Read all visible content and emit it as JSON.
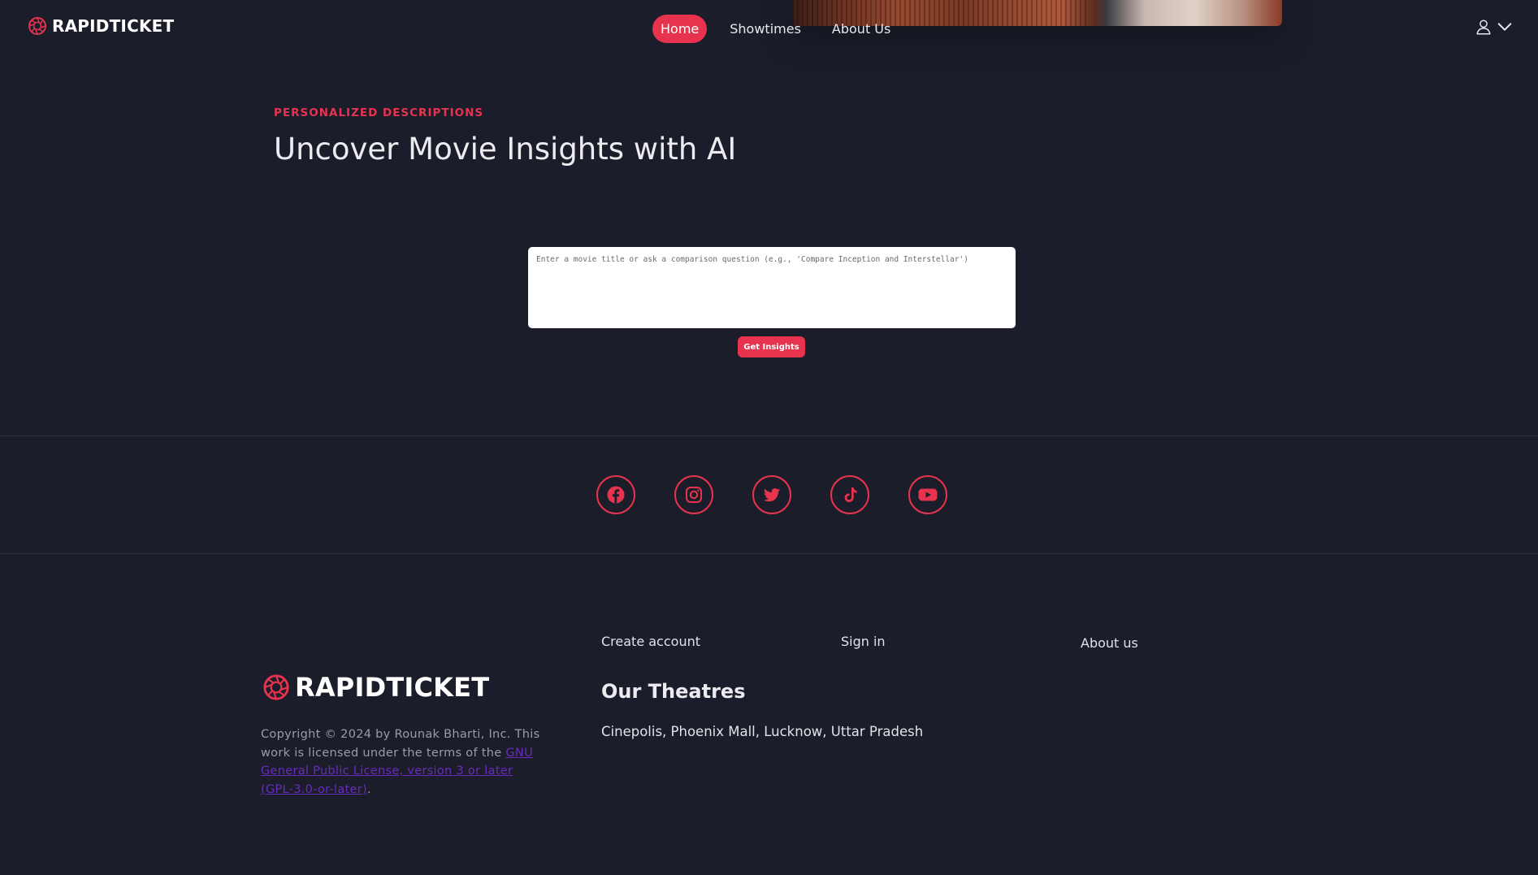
{
  "brand": {
    "name": "RAPIDTICKET",
    "accent_color": "#e8334f"
  },
  "nav": {
    "items": [
      {
        "label": "Home",
        "active": true
      },
      {
        "label": "Showtimes",
        "active": false
      },
      {
        "label": "About Us",
        "active": false
      }
    ]
  },
  "user_menu": {
    "icons": [
      "user-icon",
      "chevron-down-icon"
    ]
  },
  "hero": {
    "eyebrow": "PERSONALIZED DESCRIPTIONS",
    "title": "Uncover Movie Insights with AI",
    "query_placeholder": "Enter a movie title or ask a comparison question (e.g., 'Compare Inception and Interstellar')",
    "query_value": "",
    "button_label": "Get Insights"
  },
  "socials": [
    "facebook-icon",
    "instagram-icon",
    "twitter-icon",
    "tiktok-icon",
    "youtube-icon"
  ],
  "footer": {
    "links": {
      "create_account": "Create account",
      "sign_in": "Sign in",
      "about_us": "About us"
    },
    "brand_name": "RAPIDTICKET",
    "copyright_prefix": "Copyright © 2024 by Rounak Bharti, Inc. This work is licensed under the terms of the ",
    "license_link": "GNU General Public License, version 3 or later (GPL-3.0-or-later)",
    "copyright_suffix": ".",
    "theatres_title": "Our Theatres",
    "theatres_text": "Cinepolis, Phoenix Mall, Lucknow, Uttar Pradesh"
  },
  "colors": {
    "background": "#1b1d2a",
    "accent": "#e8334f",
    "link": "#6a2bbd"
  }
}
